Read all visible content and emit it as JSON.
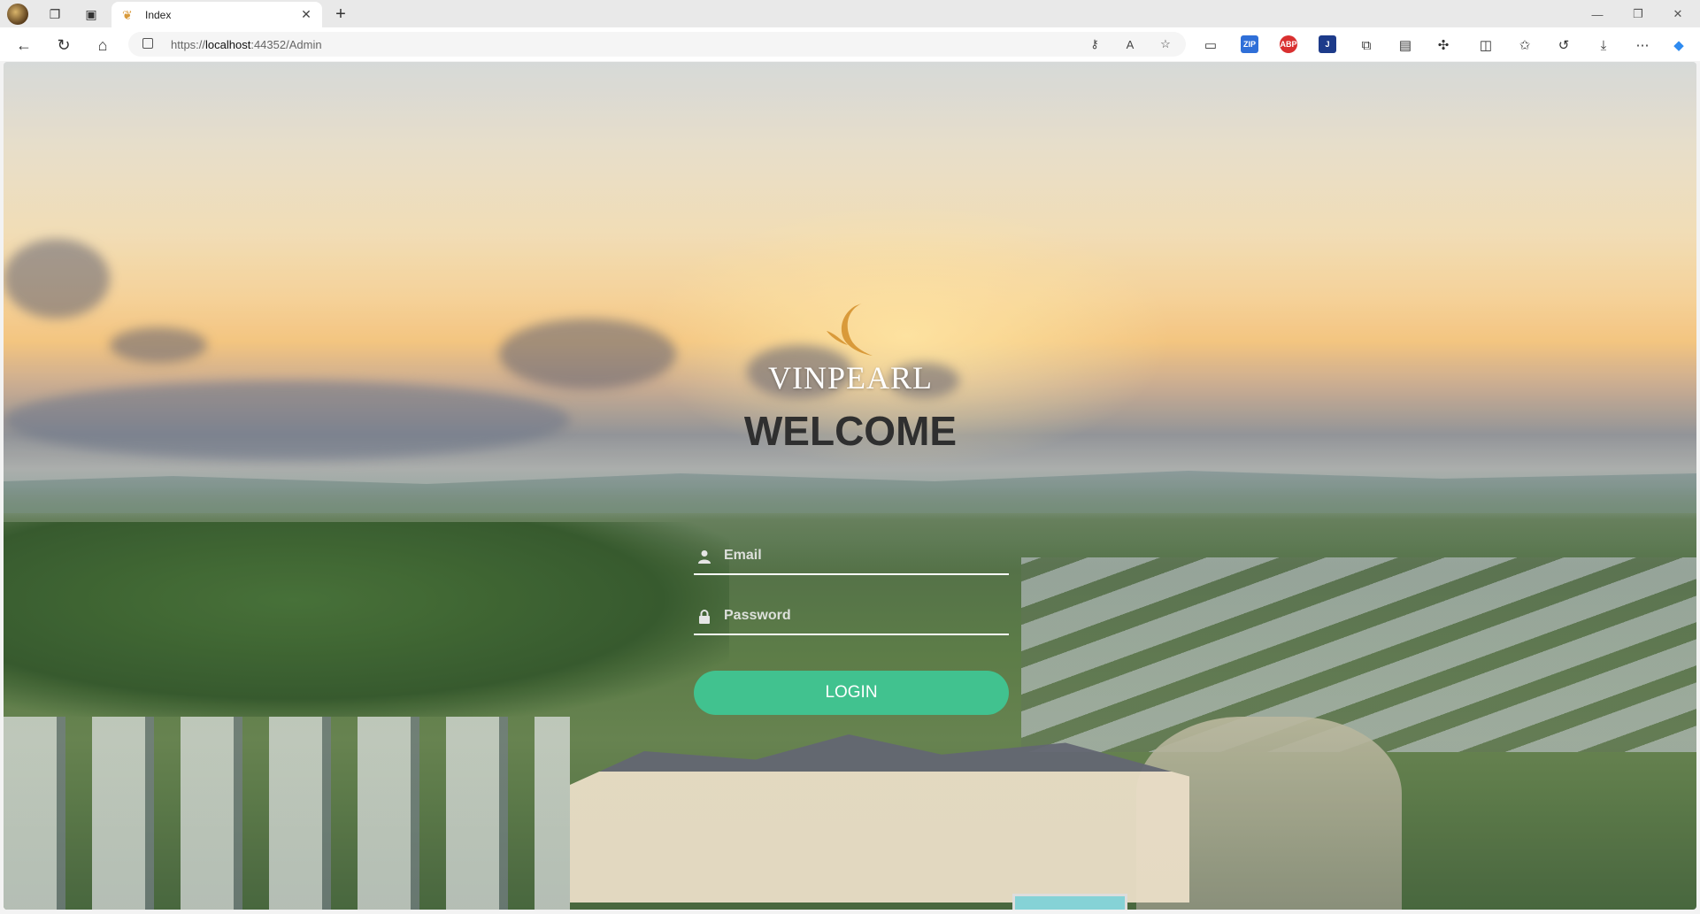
{
  "browser": {
    "tab_title": "Index",
    "url": "https://localhost:44352/Admin",
    "url_scheme": "https://",
    "url_host": "localhost",
    "url_rest": ":44352/Admin",
    "extensions": [
      "ZIP",
      "ABP"
    ]
  },
  "login": {
    "brand_name": "VINPEARL",
    "heading": "WELCOME",
    "email_placeholder": "Email",
    "password_placeholder": "Password",
    "submit_label": "LOGIN"
  },
  "colors": {
    "login_button": "#41c28f",
    "logo_gold": "#d99a3a"
  }
}
